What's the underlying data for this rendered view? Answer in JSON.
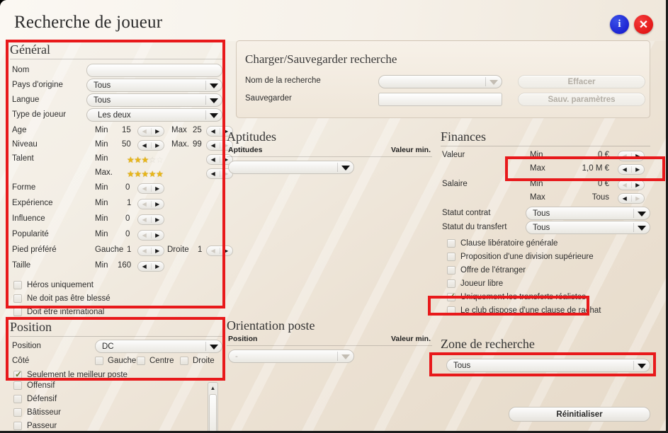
{
  "window": {
    "title": "Recherche de joueur",
    "info_icon": "info-icon",
    "close_icon": "close-icon"
  },
  "colors": {
    "accent_red": "#e8191b",
    "info_blue": "#1111c9",
    "close_red": "#dd0a0a",
    "star_gold": "#e8b617",
    "check_green": "#6b7a3a"
  },
  "general": {
    "title": "Général",
    "rows": {
      "nom": {
        "label": "Nom",
        "value": ""
      },
      "pays": {
        "label": "Pays d'origine",
        "value": "Tous"
      },
      "langue": {
        "label": "Langue",
        "value": "Tous"
      },
      "type": {
        "label": "Type de joueur",
        "value": "Les deux"
      },
      "age": {
        "label": "Age",
        "min_label": "Min",
        "min_value": "15",
        "max_label": "Max",
        "max_value": "25"
      },
      "niveau": {
        "label": "Niveau",
        "min_label": "Min",
        "min_value": "50",
        "max_label": "Max.",
        "max_value": "99"
      },
      "talent": {
        "label": "Talent",
        "min_label": "Min",
        "min_stars": 3,
        "max_label": "Max.",
        "max_stars": 5,
        "total_stars": 5
      },
      "forme": {
        "label": "Forme",
        "min_label": "Min",
        "min_value": "0"
      },
      "experience": {
        "label": "Expérience",
        "min_label": "Min",
        "min_value": "1"
      },
      "influence": {
        "label": "Influence",
        "min_label": "Min",
        "min_value": "0"
      },
      "popularite": {
        "label": "Popularité",
        "min_label": "Min",
        "min_value": "0"
      },
      "pied": {
        "label": "Pied préféré",
        "left_label": "Gauche",
        "left_value": "1",
        "right_label": "Droite",
        "right_value": "1"
      },
      "taille": {
        "label": "Taille",
        "min_label": "Min",
        "min_value": "160"
      }
    },
    "checks": [
      {
        "label": "Héros uniquement",
        "checked": false
      },
      {
        "label": "Ne doit pas être blessé",
        "checked": false
      },
      {
        "label": "Doit être international",
        "checked": false
      }
    ]
  },
  "position": {
    "title": "Position",
    "position_label": "Position",
    "position_value": "DC",
    "cote_label": "Côté",
    "cote_options": [
      {
        "label": "Gauche",
        "checked": false
      },
      {
        "label": "Centre",
        "checked": false
      },
      {
        "label": "Droite",
        "checked": false
      }
    ],
    "best_post": {
      "label": "Seulement le meilleur poste",
      "checked": true
    }
  },
  "traits_list": [
    {
      "label": "Offensif",
      "checked": false
    },
    {
      "label": "Défensif",
      "checked": false
    },
    {
      "label": "Bâtisseur",
      "checked": false
    },
    {
      "label": "Passeur",
      "checked": false
    }
  ],
  "save_search": {
    "title": "Charger/Sauvegarder recherche",
    "name_label": "Nom de la recherche",
    "name_value": "",
    "save_label": "Sauvegarder",
    "save_value": "",
    "clear_button": "Effacer",
    "save_params_button": "Sauv. paramètres"
  },
  "aptitudes": {
    "title": "Aptitudes",
    "col_name": "Aptitudes",
    "col_value": "Valeur min.",
    "select_value": ""
  },
  "orientation": {
    "title": "Orientation poste",
    "col_name": "Position",
    "col_value": "Valeur min.",
    "select_value": "-"
  },
  "finances": {
    "title": "Finances",
    "valeur": {
      "label": "Valeur",
      "min_label": "Min",
      "min_value": "0 €",
      "max_label": "Max",
      "max_value": "1,0 M €"
    },
    "salaire": {
      "label": "Salaire",
      "min_label": "Min",
      "min_value": "0 €",
      "max_label": "Max",
      "max_value": "Tous"
    },
    "statut_contrat": {
      "label": "Statut contrat",
      "value": "Tous"
    },
    "statut_transfert": {
      "label": "Statut du transfert",
      "value": "Tous"
    },
    "checks": [
      {
        "label": "Clause libératoire générale",
        "checked": false
      },
      {
        "label": "Proposition d'une division supérieure",
        "checked": false
      },
      {
        "label": "Offre de l'étranger",
        "checked": false
      },
      {
        "label": "Joueur libre",
        "checked": false
      },
      {
        "label": "Uniquement les transferts réalistes",
        "checked": true
      },
      {
        "label": "Le club dispose d'une clause de rachat",
        "checked": false
      }
    ]
  },
  "search_zone": {
    "title": "Zone de recherche",
    "value": "Tous"
  },
  "reset_button": "Réinitialiser"
}
